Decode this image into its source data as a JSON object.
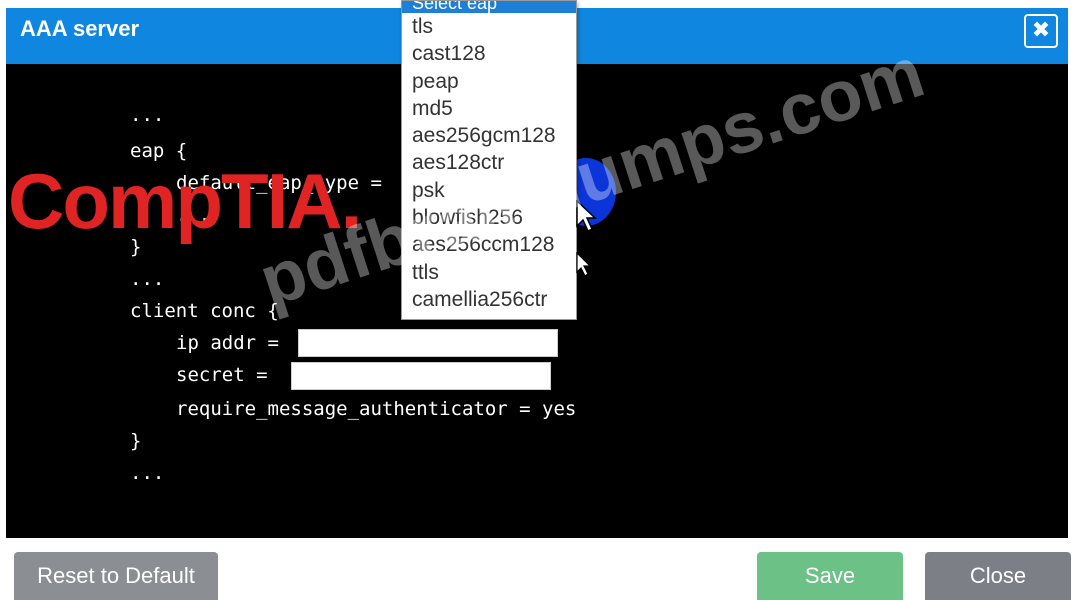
{
  "window": {
    "title": "AAA server",
    "close_glyph": "✖"
  },
  "code": {
    "lines": [
      "...",
      "eap {",
      "default_eap_type =",
      "...",
      "}",
      "...",
      "client conc {",
      "ip addr =",
      "secret =",
      "require_message_authenticator = yes",
      "}",
      "..."
    ]
  },
  "dropdown": {
    "header": "Select eap",
    "options": [
      "tls",
      "cast128",
      "peap",
      "md5",
      "aes256gcm128",
      "aes128ctr",
      "psk",
      "blowfish256",
      "aes256ccm128",
      "ttls",
      "camellia256ctr"
    ]
  },
  "fields": {
    "ip_addr_value": "",
    "secret_value": ""
  },
  "overlay": {
    "logo_text": "CompTIA.",
    "watermark_text": "pdfbraindumps.com"
  },
  "buttons": {
    "reset": "Reset to Default",
    "save": "Save",
    "close": "Close"
  },
  "colors": {
    "titlebar": "#0f86e0",
    "code_bg": "#000000",
    "reset_btn": "#8b8f94",
    "save_btn": "#6cc187",
    "close_btn": "#7c8086",
    "logo": "#e02424"
  }
}
